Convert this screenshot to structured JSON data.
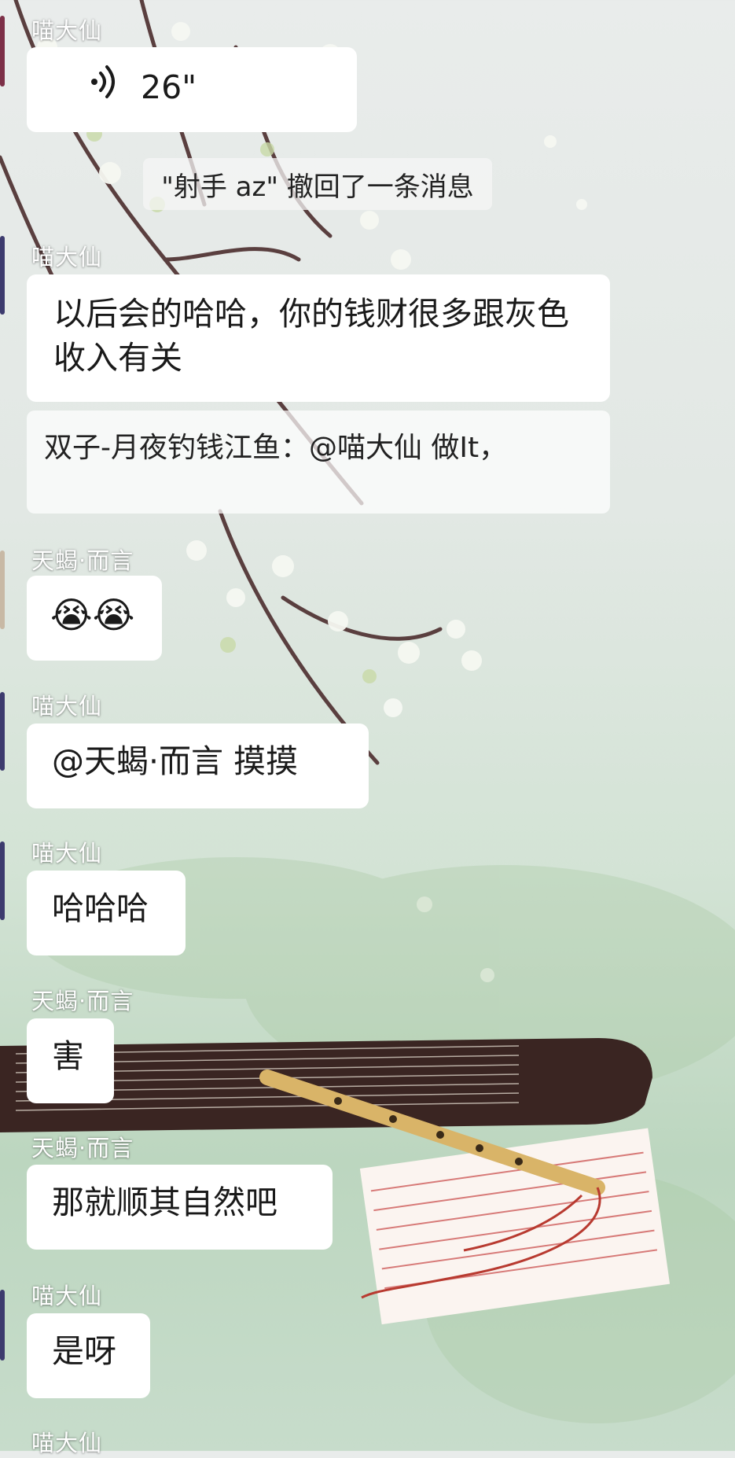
{
  "messages": [
    {
      "sender": "喵大仙",
      "type": "voice",
      "duration": "26\""
    },
    {
      "sender": "喵大仙",
      "type": "text",
      "text": "以后会的哈哈，你的钱财很多跟灰色收入有关"
    },
    {
      "sender": "天蝎·而言",
      "type": "emoji",
      "text": "😭😭"
    },
    {
      "sender": "喵大仙",
      "type": "text",
      "text": "@天蝎·而言  摸摸"
    },
    {
      "sender": "喵大仙",
      "type": "text",
      "text": "哈哈哈"
    },
    {
      "sender": "天蝎·而言",
      "type": "text",
      "text": "害"
    },
    {
      "sender": "天蝎·而言",
      "type": "text",
      "text": "那就顺其自然吧"
    },
    {
      "sender": "喵大仙",
      "type": "text",
      "text": "是呀"
    },
    {
      "sender": "喵大仙",
      "type": "partial"
    }
  ],
  "system_notice": "\"射手 az\" 撤回了一条消息",
  "quote": {
    "text": "双子-月夜钓钱江鱼：@喵大仙 做It，"
  },
  "icons": {
    "voice": "voice-wave-icon"
  },
  "colors": {
    "bubble": "#ffffff",
    "text": "#1a1a1a",
    "background_green": "#bcd6bf"
  }
}
